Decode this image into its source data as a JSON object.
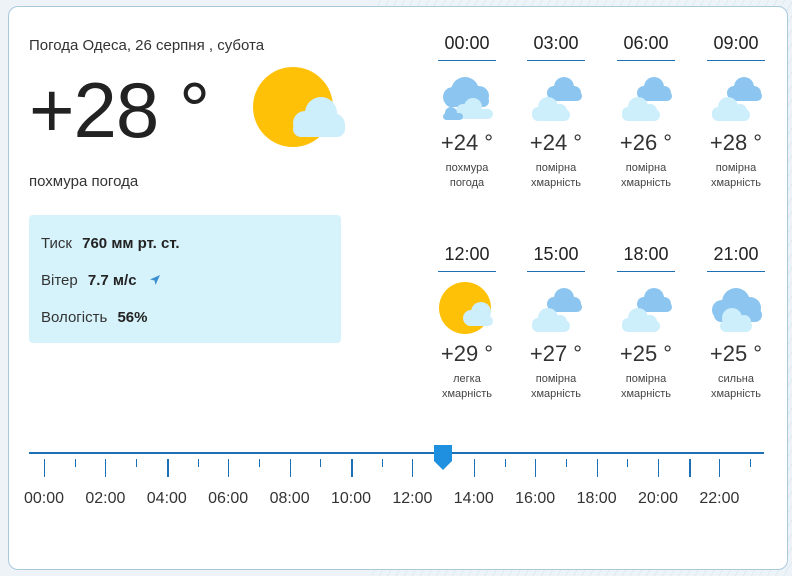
{
  "header": {
    "title": "Погода Одеса, 26 серпня , субота",
    "temp": "+28 °",
    "condition": "похмура погода",
    "icon": "sun-cloud-icon"
  },
  "details": {
    "pressure_label": "Тиск",
    "pressure_value": "760 мм рт. ст.",
    "wind_label": "Вітер",
    "wind_value": "7.7 м/с",
    "wind_icon": "wind-direction-arrow-icon",
    "humidity_label": "Вологість",
    "humidity_value": "56%"
  },
  "hourly": [
    {
      "time": "00:00",
      "temp": "+24 °",
      "cond1": "похмура",
      "cond2": "погода",
      "icon": "overcast-icon"
    },
    {
      "time": "03:00",
      "temp": "+24 °",
      "cond1": "помірна",
      "cond2": "хмарність",
      "icon": "partly-cloudy-icon"
    },
    {
      "time": "06:00",
      "temp": "+26 °",
      "cond1": "помірна",
      "cond2": "хмарність",
      "icon": "partly-cloudy-icon"
    },
    {
      "time": "09:00",
      "temp": "+28 °",
      "cond1": "помірна",
      "cond2": "хмарність",
      "icon": "partly-cloudy-icon"
    },
    {
      "time": "12:00",
      "temp": "+29 °",
      "cond1": "легка",
      "cond2": "хмарність",
      "icon": "sun-cloud-icon"
    },
    {
      "time": "15:00",
      "temp": "+27 °",
      "cond1": "помірна",
      "cond2": "хмарність",
      "icon": "partly-cloudy-icon"
    },
    {
      "time": "18:00",
      "temp": "+25 °",
      "cond1": "помірна",
      "cond2": "хмарність",
      "icon": "partly-cloudy-icon"
    },
    {
      "time": "21:00",
      "temp": "+25 °",
      "cond1": "сильна",
      "cond2": "хмарність",
      "icon": "heavy-cloud-icon"
    }
  ],
  "timeline": {
    "labels": [
      "00:00",
      "02:00",
      "04:00",
      "06:00",
      "08:00",
      "10:00",
      "12:00",
      "14:00",
      "16:00",
      "18:00",
      "20:00",
      "22:00"
    ],
    "selected_hour": 13,
    "accent": "#1f6fb5"
  },
  "colors": {
    "sun": "#ffc107",
    "cloud_light": "#cdeefb",
    "cloud_blue": "#8cc6f0",
    "panel": "#d6f3fb",
    "border": "#a9c9dd"
  }
}
